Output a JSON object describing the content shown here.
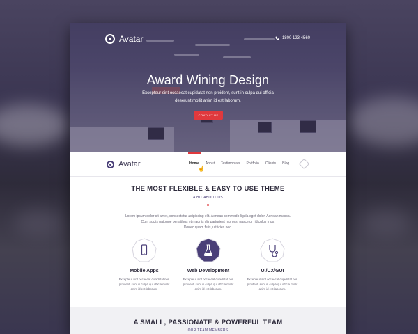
{
  "hero": {
    "brand": "Avatar",
    "phone": "1800 123 4560",
    "title": "Award Wining Design",
    "text_line1": "Excepteur sint occaecat cupidatat non proident, sunt in culpa qui officia",
    "text_line2": "deserunt mollit anim id est laborum.",
    "cta_label": "CONTACT US"
  },
  "nav": {
    "brand": "Avatar",
    "items": [
      {
        "label": "Home"
      },
      {
        "label": "About"
      },
      {
        "label": "Testimonials"
      },
      {
        "label": "Portfolio"
      },
      {
        "label": "Clients"
      },
      {
        "label": "Blog"
      }
    ]
  },
  "about": {
    "title": "THE MOST FLEXIBLE & EASY TO USE THEME",
    "subtitle": "A BIT ABOUT US",
    "text_line1": "Lorem ipsum dolor sit amet, consectetur adipiscing elit. Aenean commodo ligula eget dolor. Aenean massa.",
    "text_line2": "Cum sociis natoque penatibus et magnis dis parturient montes, nascetur ridiculus mus.",
    "text_line3": "Donec quam felis, ultricies nec."
  },
  "features": [
    {
      "title": "Mobile Apps",
      "icon": "mobile-phone-icon",
      "line1": "Excepteur sint occaecat cupidatat non",
      "line2": "proident, sunt in culpa qui officia mollit",
      "line3": "anim id est laborum."
    },
    {
      "title": "Web Development",
      "icon": "flask-icon",
      "line1": "Excepteur sint occaecat cupidatat non",
      "line2": "proident, sunt in culpa qui officia mollit",
      "line3": "anim id est laborum."
    },
    {
      "title": "UI/UX/GUI",
      "icon": "stethoscope-icon",
      "line1": "Excepteur sint occaecat cupidatat non",
      "line2": "proident, sunt in culpa qui officia mollit",
      "line3": "anim id est laborum."
    }
  ],
  "team": {
    "title": "A SMALL, PASSIONATE & POWERFUL TEAM",
    "subtitle": "OUR TEAM MEMBERS"
  },
  "colors": {
    "accent": "#e0393d",
    "brand": "#4a3f78"
  }
}
